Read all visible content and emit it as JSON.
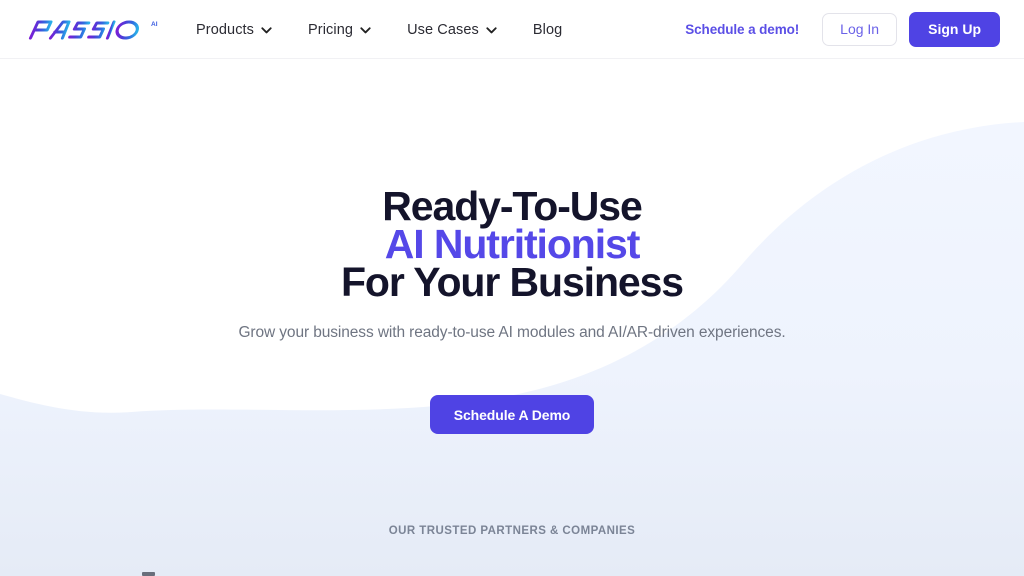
{
  "site": {
    "brand_name": "PASSIO",
    "brand_superscript": "AI",
    "logo_icon": "passio-gradient-wordmark"
  },
  "colors": {
    "primary_purple": "#4f43e4",
    "heading_accent_purple": "#5548e8",
    "demo_link_purple": "#5b4fe6",
    "login_text_purple": "#6b62e8",
    "heading_dark": "#14142b",
    "body_gray": "#6f7582",
    "partners_gray": "#7b8496",
    "wave_light_blue": "#eff4fe",
    "wave_bottom_blue": "#e6ecf6",
    "page_white": "#ffffff",
    "header_border": "#f1f1f4",
    "login_border": "#e3e3ea"
  },
  "header": {
    "nav": [
      {
        "label": "Products",
        "has_dropdown": true,
        "icon": "chevron-down-icon"
      },
      {
        "label": "Pricing",
        "has_dropdown": true,
        "icon": "chevron-down-icon"
      },
      {
        "label": "Use Cases",
        "has_dropdown": true,
        "icon": "chevron-down-icon"
      },
      {
        "label": "Blog",
        "has_dropdown": false,
        "icon": ""
      }
    ],
    "demo_link": "Schedule a demo!",
    "login_label": "Log In",
    "signup_label": "Sign Up"
  },
  "hero": {
    "headline_line1": "Ready-To-Use",
    "headline_line2": "AI Nutritionist",
    "headline_line3": "For Your Business",
    "subheadline": "Grow your business with ready-to-use AI modules and AI/AR-driven experiences.",
    "cta_label": "Schedule A Demo"
  },
  "partners": {
    "section_label": "OUR TRUSTED PARTNERS & COMPANIES"
  }
}
